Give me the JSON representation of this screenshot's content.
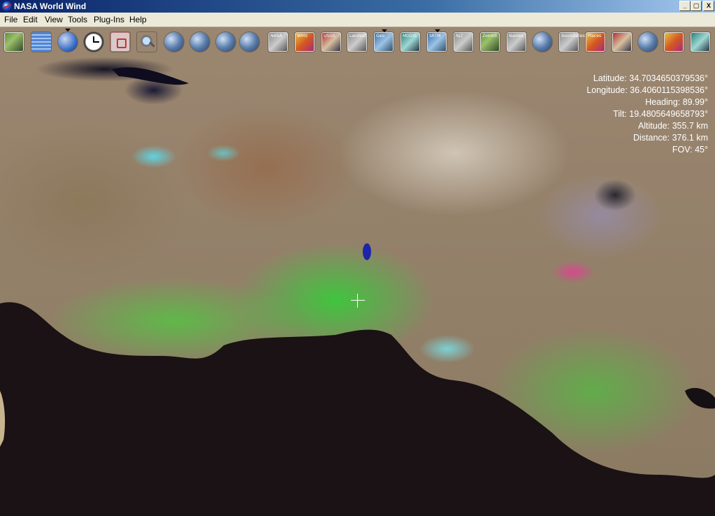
{
  "window": {
    "title": "NASA World Wind",
    "minimize_label": "0",
    "maximize_label": "1",
    "close_label": "X"
  },
  "menu": {
    "items": [
      "File",
      "Edit",
      "View",
      "Tools",
      "Plug-Ins",
      "Help"
    ]
  },
  "toolbar": {
    "icons": [
      "layer-manager-icon",
      "grid-icon",
      "globe-icon",
      "clock-icon",
      "target-icon",
      "magnifier-icon",
      "earth-icon",
      "moon-icon",
      "blue-marble-icon",
      "planet-icon",
      "layer-icon",
      "layer-icon",
      "layer-icon",
      "layer-icon",
      "layer-icon",
      "layer-icon",
      "layer-icon",
      "layer-icon",
      "layer-icon",
      "layer-icon",
      "layer-icon",
      "layer-icon",
      "layer-icon",
      "layer-icon",
      "layer-icon",
      "layer-icon",
      "layer-icon"
    ],
    "captions": [
      "NASA",
      "WMS",
      "USGS",
      "Landsat",
      "Geo",
      "MODIS",
      "SRTM",
      "NLT",
      "Zoomit",
      "Names",
      "Boundaries",
      "Places"
    ]
  },
  "status": {
    "latitude": "Latitude: 34.7034650379536°",
    "longitude": "Longitude: 36.4060115398536°",
    "heading": "Heading: 89.99°",
    "tilt": "Tilt: 19.4805649658793°",
    "altitude": "Altitude: 355.7 km",
    "distance": "Distance: 376.1 km",
    "fov": "FOV: 45°"
  },
  "colors": {
    "titlebar_start": "#0a246a",
    "titlebar_end": "#a6caf0",
    "menubar": "#ece9d8",
    "ocean": "#1a1214",
    "vegetation": "#4fbf45"
  }
}
